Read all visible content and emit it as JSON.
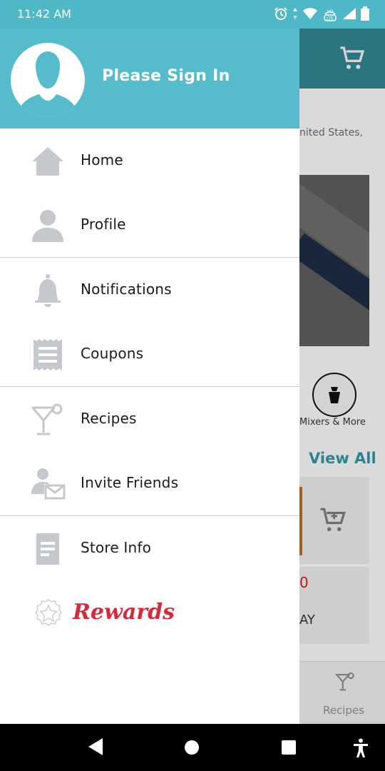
{
  "status_bar": {
    "time": "11:42 AM",
    "icons": [
      "alarm-icon",
      "data-arrows-icon",
      "wifi-icon",
      "volte-icon",
      "signal-icon",
      "battery-icon"
    ],
    "volte_text": "VO LTE"
  },
  "background_app": {
    "location_text": "nited States,",
    "category_label": "Mixers & More",
    "view_all": "View All",
    "price_fragment": "0",
    "card_text_fragment": "AY",
    "tab_label": "Recipes"
  },
  "drawer": {
    "header": {
      "signin_text": "Please Sign In",
      "color": "#56bccb"
    },
    "items": [
      {
        "id": "home",
        "label": "Home",
        "icon": "home-icon"
      },
      {
        "id": "profile",
        "label": "Profile",
        "icon": "person-icon"
      },
      {
        "id": "notifications",
        "label": "Notifications",
        "icon": "bell-icon"
      },
      {
        "id": "coupons",
        "label": "Coupons",
        "icon": "coupon-icon"
      },
      {
        "id": "recipes",
        "label": "Recipes",
        "icon": "cocktail-icon"
      },
      {
        "id": "invite",
        "label": "Invite Friends",
        "icon": "invite-icon"
      },
      {
        "id": "store",
        "label": "Store Info",
        "icon": "document-icon"
      }
    ],
    "rewards": {
      "label": "Rewards",
      "icon": "star-badge-icon",
      "color": "#d42a3b"
    }
  },
  "nav_bar": {
    "buttons": [
      "back-icon",
      "home-circle-icon",
      "recents-icon",
      "accessibility-icon"
    ]
  },
  "colors": {
    "accent": "#56bccb",
    "icon_gray": "#c5c8cc",
    "header_dark": "#2e7f8b"
  }
}
